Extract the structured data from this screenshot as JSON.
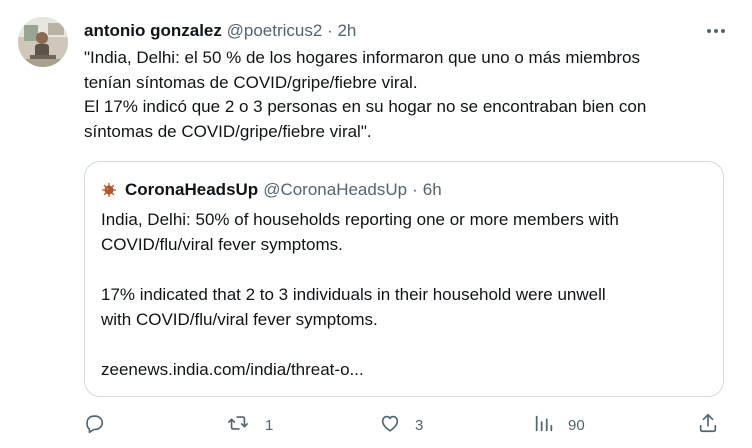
{
  "tweet": {
    "author_name": "antonio gonzalez",
    "author_handle": "@poetricus2",
    "separator": "·",
    "time": "2h",
    "lines": [
      "\"India, Delhi: el 50 % de los hogares informaron que uno o más miembros",
      "tenían síntomas de COVID/gripe/fiebre viral.",
      "El 17% indicó que 2 o 3 personas en su hogar no se encontraban bien con",
      "síntomas de COVID/gripe/fiebre viral\"."
    ]
  },
  "quote": {
    "author_name": "CoronaHeadsUp",
    "author_handle": "@CoronaHeadsUp",
    "separator": "·",
    "time": "6h",
    "lines": [
      "India, Delhi: 50% of households reporting one or more members with",
      "COVID/flu/viral fever symptoms.",
      "",
      "17% indicated that 2 to 3 individuals in their household were unwell",
      "with COVID/flu/viral fever symptoms.",
      "",
      "zeenews.india.com/india/threat-o..."
    ]
  },
  "actions": {
    "reply_count": "",
    "retweet_count": "1",
    "like_count": "3",
    "views_count": "90"
  },
  "icons": {
    "more": "more-dots-icon",
    "reply": "reply-icon",
    "retweet": "retweet-icon",
    "like": "heart-icon",
    "views": "views-icon",
    "share": "share-icon"
  },
  "colors": {
    "text": "#0f1419",
    "secondary": "#536471",
    "border": "#cfd9de",
    "virus": "#b0562a"
  }
}
